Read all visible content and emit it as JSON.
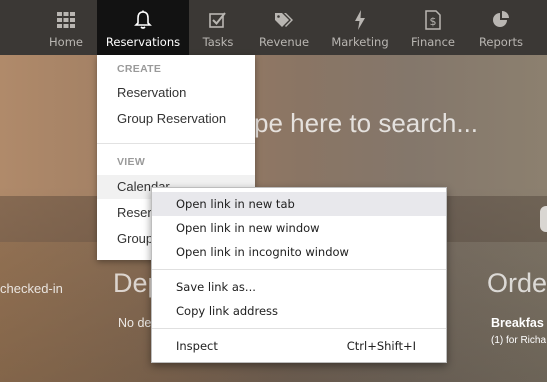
{
  "nav": {
    "items": [
      {
        "label": "Home",
        "icon": "grid-icon"
      },
      {
        "label": "Reservations",
        "icon": "bell-icon",
        "active": true
      },
      {
        "label": "Tasks",
        "icon": "checkbox-icon"
      },
      {
        "label": "Revenue",
        "icon": "tags-icon"
      },
      {
        "label": "Marketing",
        "icon": "bolt-icon"
      },
      {
        "label": "Finance",
        "icon": "dollar-doc-icon"
      },
      {
        "label": "Reports",
        "icon": "pie-chart-icon"
      }
    ]
  },
  "search": {
    "hint": "pe here to search..."
  },
  "background": {
    "checked_in": "checked-in",
    "dep_heading": "Dep",
    "order_heading": "Orde",
    "no_dep": "No de",
    "breakfast": "Breakfas",
    "for_rich": "(1) for Richa"
  },
  "dropdown": {
    "create_label": "CREATE",
    "create_items": [
      "Reservation",
      "Group Reservation"
    ],
    "view_label": "VIEW",
    "view_items": [
      "Calendar",
      "Reservations",
      "Group Reservations"
    ]
  },
  "context_menu": {
    "items": [
      {
        "label": "Open link in new tab"
      },
      {
        "label": "Open link in new window"
      },
      {
        "label": "Open link in incognito window"
      },
      {
        "label": "Save link as..."
      },
      {
        "label": "Copy link address"
      },
      {
        "label": "Inspect",
        "shortcut": "Ctrl+Shift+I"
      }
    ]
  },
  "colors": {
    "nav_bg": "#3b3835",
    "nav_active_bg": "#121212",
    "menu_hover": "#e8e8ec"
  }
}
